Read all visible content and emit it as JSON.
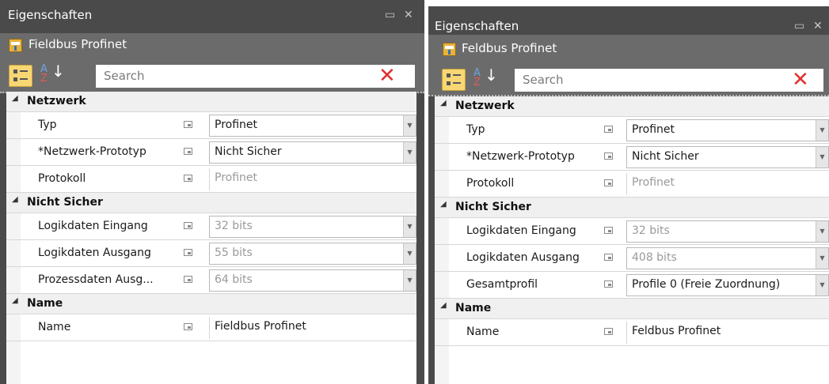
{
  "left": {
    "title": "Eigenschaften",
    "object_name": "Fieldbus Profinet",
    "search_placeholder": "Search",
    "categories": [
      {
        "label": "Netzwerk",
        "rows": [
          {
            "name": "Typ",
            "value": "Profinet",
            "dropdown": true,
            "muted": false
          },
          {
            "name": "*Netzwerk-Prototyp",
            "value": "Nicht Sicher",
            "dropdown": true,
            "muted": false
          },
          {
            "name": "Protokoll",
            "value": "Profinet",
            "dropdown": false,
            "muted": true
          }
        ]
      },
      {
        "label": "Nicht Sicher",
        "rows": [
          {
            "name": "Logikdaten Eingang",
            "value": "32 bits",
            "dropdown": true,
            "muted": true
          },
          {
            "name": "Logikdaten Ausgang",
            "value": "55 bits",
            "dropdown": true,
            "muted": true
          },
          {
            "name": "Prozessdaten Ausg...",
            "value": "64 bits",
            "dropdown": true,
            "muted": true
          }
        ]
      },
      {
        "label": "Name",
        "rows": [
          {
            "name": "Name",
            "value": "Fieldbus Profinet",
            "dropdown": false,
            "muted": false
          }
        ]
      }
    ]
  },
  "right": {
    "title": "Eigenschaften",
    "object_name": "Feldbus Profinet",
    "search_placeholder": "Search",
    "categories": [
      {
        "label": "Netzwerk",
        "rows": [
          {
            "name": "Typ",
            "value": "Profinet",
            "dropdown": true,
            "muted": false
          },
          {
            "name": "*Netzwerk-Prototyp",
            "value": "Nicht Sicher",
            "dropdown": true,
            "muted": false
          },
          {
            "name": "Protokoll",
            "value": "Profinet",
            "dropdown": false,
            "muted": true
          }
        ]
      },
      {
        "label": "Nicht Sicher",
        "rows": [
          {
            "name": "Logikdaten Eingang",
            "value": "32 bits",
            "dropdown": true,
            "muted": true
          },
          {
            "name": "Logikdaten Ausgang",
            "value": "408 bits",
            "dropdown": true,
            "muted": true
          },
          {
            "name": "Gesamtprofil",
            "value": "Profile 0 (Freie Zuordnung)",
            "dropdown": true,
            "muted": false
          }
        ]
      },
      {
        "label": "Name",
        "rows": [
          {
            "name": "Name",
            "value": "Feldbus Profinet",
            "dropdown": false,
            "muted": false
          }
        ]
      }
    ]
  },
  "icons": {
    "maximize": "maximize-icon",
    "close": "close-icon",
    "clear_search": "clear-search-icon",
    "categorized": "categorized-view-icon",
    "alphabetical": "sort-alphabetical-icon",
    "collapse": "collapse-triangle-icon",
    "pin": "property-pin-icon"
  },
  "colors": {
    "panel_dark": "#4a4a4a",
    "panel_mid": "#6b6b6b",
    "toolbar_active": "#f7d774",
    "clear_red": "#e03030"
  }
}
